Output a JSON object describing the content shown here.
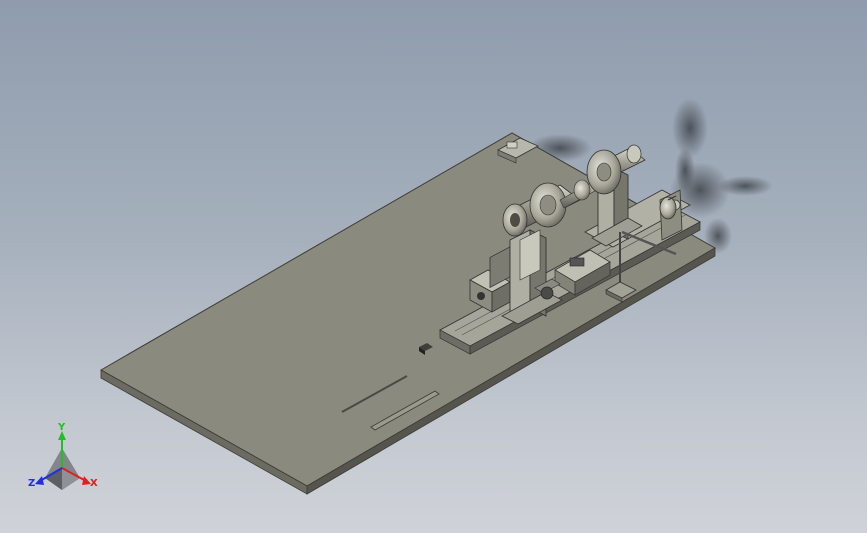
{
  "viewport": {
    "background_top": "#8f9cad",
    "background_bottom": "#cfd2d8"
  },
  "model": {
    "plate_color": "#8a8a7e",
    "part_color": "#a3a296",
    "shadow_color": "#2f3236"
  },
  "triad": {
    "x_label": "X",
    "y_label": "Y",
    "z_label": "Z",
    "x_color": "#e02020",
    "y_color": "#20c020",
    "z_color": "#2030e0"
  }
}
